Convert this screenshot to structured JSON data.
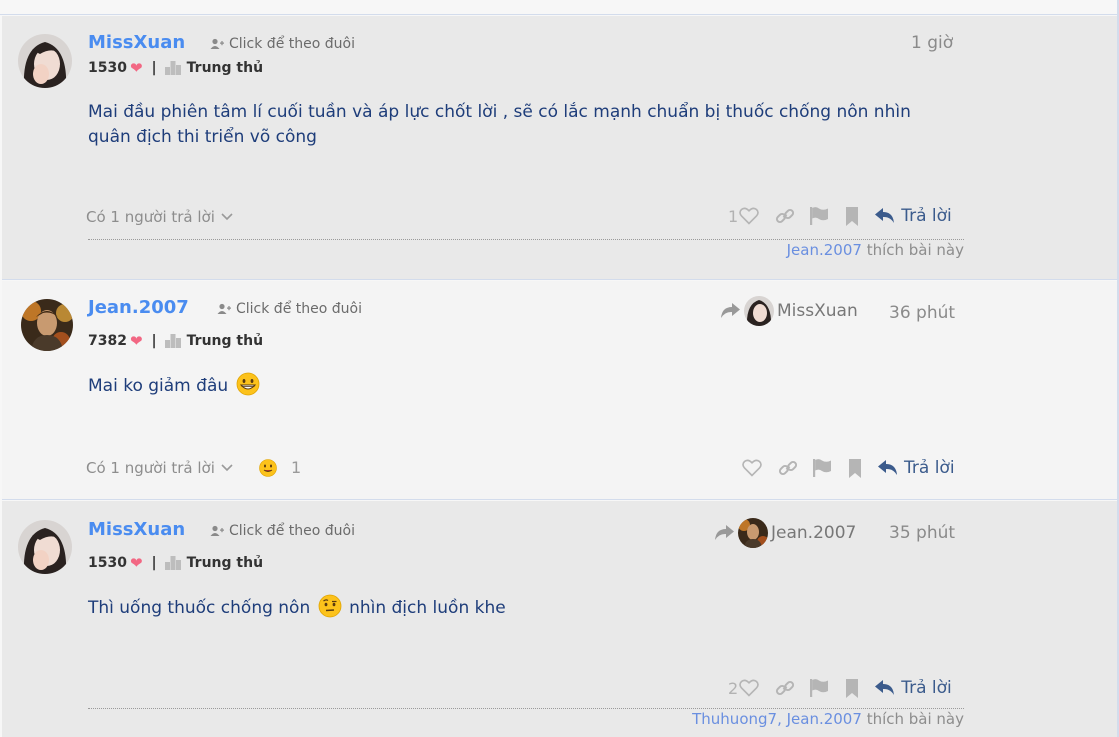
{
  "posts": [
    {
      "username": "MissXuan",
      "follow_label": "Click để theo đuôi",
      "points": "1530",
      "rank": "Trung thủ",
      "time": "1 giờ",
      "content": "Mai đầu phiên tâm lí cuối tuần và áp lực chốt lời , sẽ có lắc mạnh chuẩn bị thuốc chống nôn nhìn quân địch thi triển võ công",
      "replies": "Có 1 người trả lời",
      "like_count": "1",
      "reply_label": "Trả lời",
      "liked_by": [
        "Jean.2007"
      ],
      "liked_suffix": "thích bài này"
    },
    {
      "username": "Jean.2007",
      "follow_label": "Click để theo đuôi",
      "points": "7382",
      "rank": "Trung thủ",
      "reply_to": "MissXuan",
      "time": "36 phút",
      "content": "Mai ko giảm đâu",
      "content_emoji": "grinning-face",
      "replies": "Có 1 người trả lời",
      "reaction_count": "1",
      "reply_label": "Trả lời"
    },
    {
      "username": "MissXuan",
      "follow_label": "Click để theo đuôi",
      "points": "1530",
      "rank": "Trung thủ",
      "reply_to": "Jean.2007",
      "time": "35 phút",
      "content_before": "Thì uống thuốc chống nôn",
      "content_after": "nhìn địch luồn khe",
      "content_emoji": "face-with-raised-eyebrow",
      "like_count": "2",
      "reply_label": "Trả lời",
      "liked_by_text": "Thuhuong7, Jean.2007",
      "liked_suffix": "thích bài này"
    }
  ],
  "colors": {
    "username": "#4a8cf0",
    "content": "#1e3d7a",
    "heart": "#f26783",
    "reply_button": "#3b5b8c"
  }
}
